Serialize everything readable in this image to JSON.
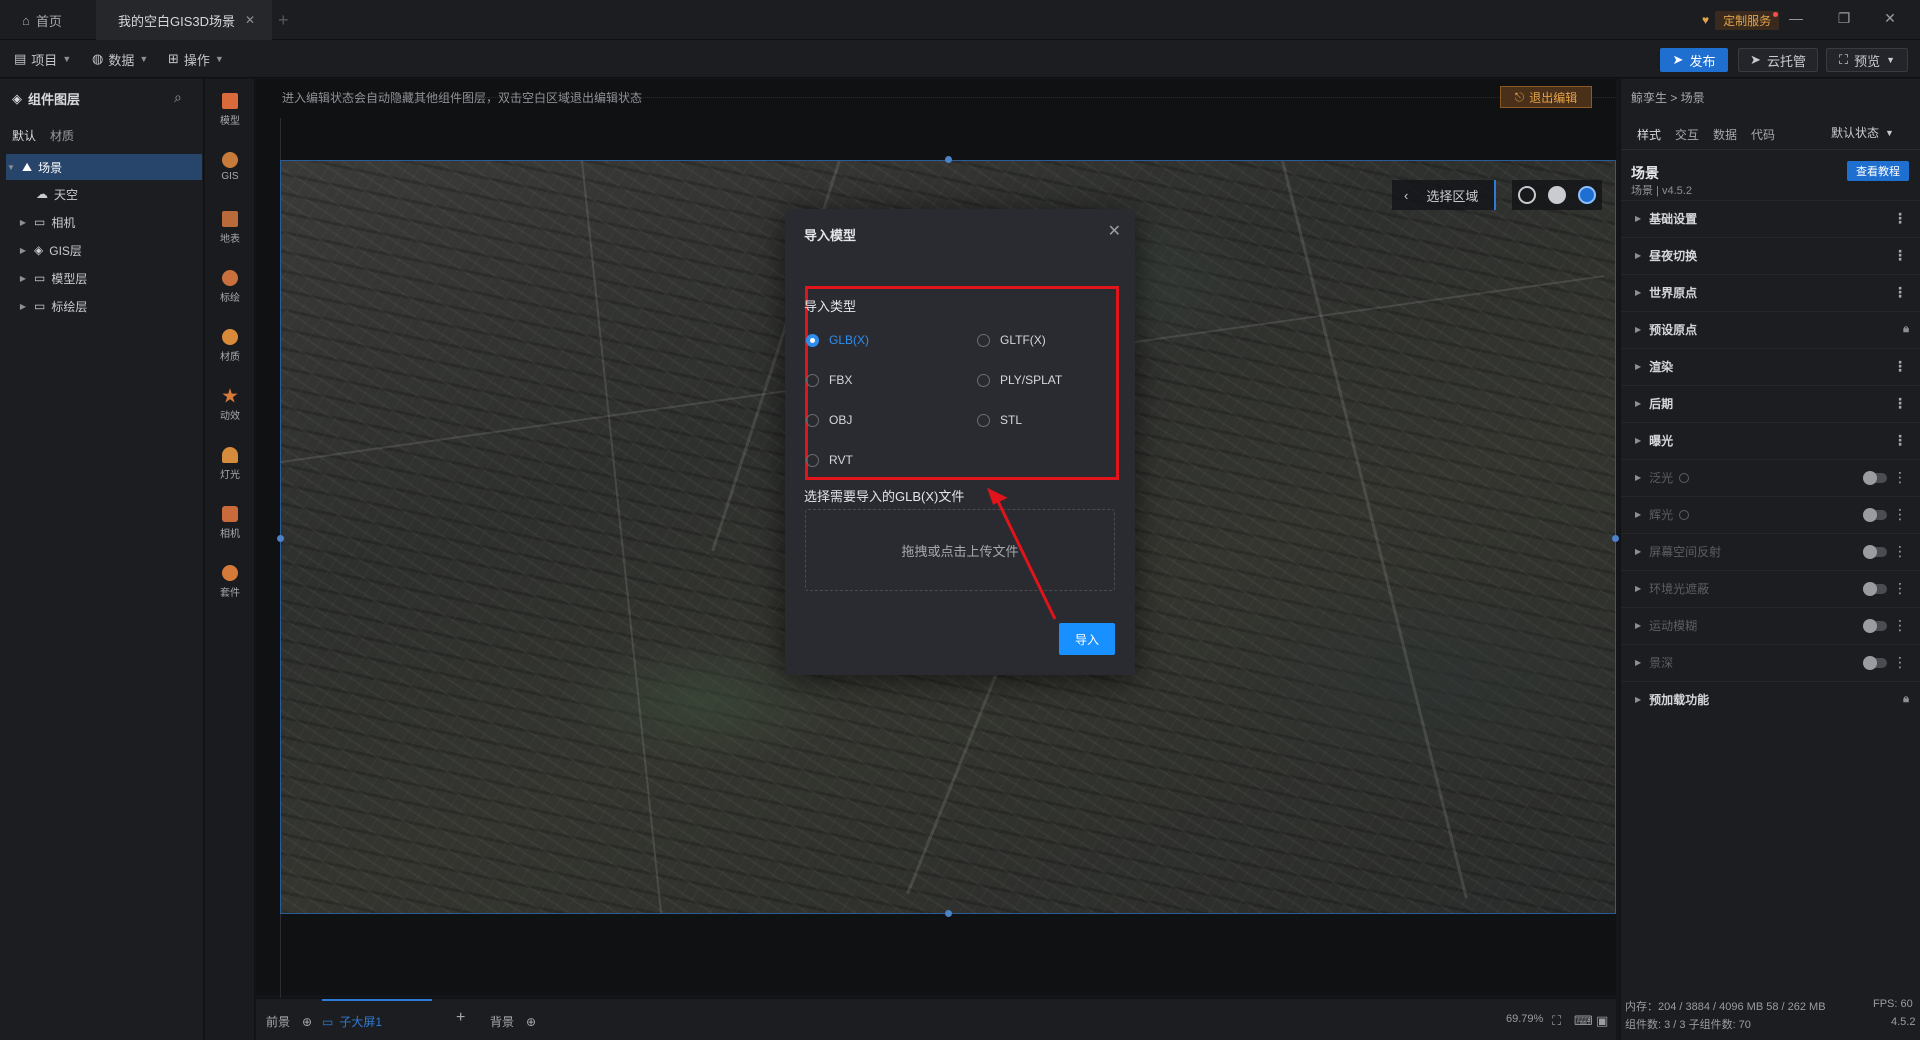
{
  "titlebar": {
    "home_tab": "首页",
    "active_tab": "我的空白GIS3D场景",
    "custom_service": "定制服务"
  },
  "toolbar": {
    "menus": [
      "项目",
      "数据",
      "操作"
    ],
    "publish": "发布",
    "cloud": "云托管",
    "preview": "预览"
  },
  "layers": {
    "title": "组件图层",
    "tabs": [
      "默认",
      "材质"
    ],
    "tree": [
      {
        "label": "场景",
        "icon": "mountain-icon"
      },
      {
        "label": "天空",
        "icon": "cloud-icon"
      },
      {
        "label": "相机",
        "icon": "folder-icon"
      },
      {
        "label": "GIS层",
        "icon": "layers-icon"
      },
      {
        "label": "模型层",
        "icon": "folder-icon"
      },
      {
        "label": "标绘层",
        "icon": "folder-icon"
      }
    ]
  },
  "components": [
    {
      "label": "模型",
      "color": "#d96a3b"
    },
    {
      "label": "GIS",
      "color": "#c77b3a"
    },
    {
      "label": "地表",
      "color": "#b86a3a"
    },
    {
      "label": "标绘",
      "color": "#c9703c"
    },
    {
      "label": "材质",
      "color": "#d88a3a"
    },
    {
      "label": "动效",
      "color": "#d87a3a"
    },
    {
      "label": "灯光",
      "color": "#d58a3c"
    },
    {
      "label": "相机",
      "color": "#c96a3c"
    },
    {
      "label": "套件",
      "color": "#d67a3a"
    }
  ],
  "canvas": {
    "notice": "进入编辑状态会自动隐藏其他组件图层，双击空白区域退出编辑状态",
    "exit_edit": "退出编辑",
    "region": "选择区域"
  },
  "modal": {
    "title": "导入模型",
    "type_label": "导入类型",
    "options": [
      "GLB(X)",
      "GLTF(X)",
      "FBX",
      "PLY/SPLAT",
      "OBJ",
      "STL",
      "RVT"
    ],
    "selected": "GLB(X)",
    "file_label": "选择需要导入的GLB(X)文件",
    "drop_text": "拖拽或点击上传文件",
    "import": "导入"
  },
  "bottombar": {
    "foreground": "前景",
    "screen": "子大屏1",
    "background": "背景",
    "zoom": "69.79%"
  },
  "props": {
    "crumb": "鲸孪生 > 场景",
    "tabs": [
      "样式",
      "交互",
      "数据",
      "代码"
    ],
    "state": "默认状态",
    "scene_name": "场景",
    "scene_version": "场景 | v4.5.2",
    "tutorial": "查看教程",
    "sections": [
      {
        "label": "基础设置",
        "kind": "more",
        "disabled": false
      },
      {
        "label": "昼夜切换",
        "kind": "more",
        "disabled": false
      },
      {
        "label": "世界原点",
        "kind": "more",
        "disabled": false
      },
      {
        "label": "预设原点",
        "kind": "lock",
        "disabled": false
      },
      {
        "label": "渲染",
        "kind": "more",
        "disabled": false
      },
      {
        "label": "后期",
        "kind": "more",
        "disabled": false
      },
      {
        "label": "曝光",
        "kind": "more",
        "disabled": false
      },
      {
        "label": "泛光",
        "kind": "toggle",
        "disabled": true
      },
      {
        "label": "辉光",
        "kind": "toggle",
        "disabled": true
      },
      {
        "label": "屏幕空间反射",
        "kind": "toggle",
        "disabled": true
      },
      {
        "label": "环境光遮蔽",
        "kind": "toggle",
        "disabled": true
      },
      {
        "label": "运动模糊",
        "kind": "toggle",
        "disabled": true
      },
      {
        "label": "景深",
        "kind": "toggle",
        "disabled": true
      },
      {
        "label": "预加载功能",
        "kind": "lock",
        "disabled": false
      }
    ],
    "memory": "内存：204 / 3884 / 4096 MB  58 / 262 MB",
    "fps": "FPS:  60",
    "counts": "组件数: 3 / 3   子组件数: 70",
    "version": "4.5.2"
  }
}
